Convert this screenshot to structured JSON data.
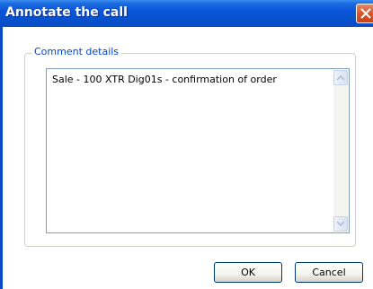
{
  "window": {
    "title": "Annotate the call"
  },
  "comment_group": {
    "legend": "Comment details",
    "text_value": "Sale - 100 XTR Dig01s - confirmation of order"
  },
  "buttons": {
    "ok_label": "OK",
    "cancel_label": "Cancel"
  },
  "colors": {
    "titlebar": "#0a55d8",
    "legend_text": "#0046d5",
    "close_button": "#d95a2f"
  },
  "icons": {
    "close": "close-icon",
    "scroll_up": "scroll-up-arrow-icon",
    "scroll_down": "scroll-down-arrow-icon"
  }
}
